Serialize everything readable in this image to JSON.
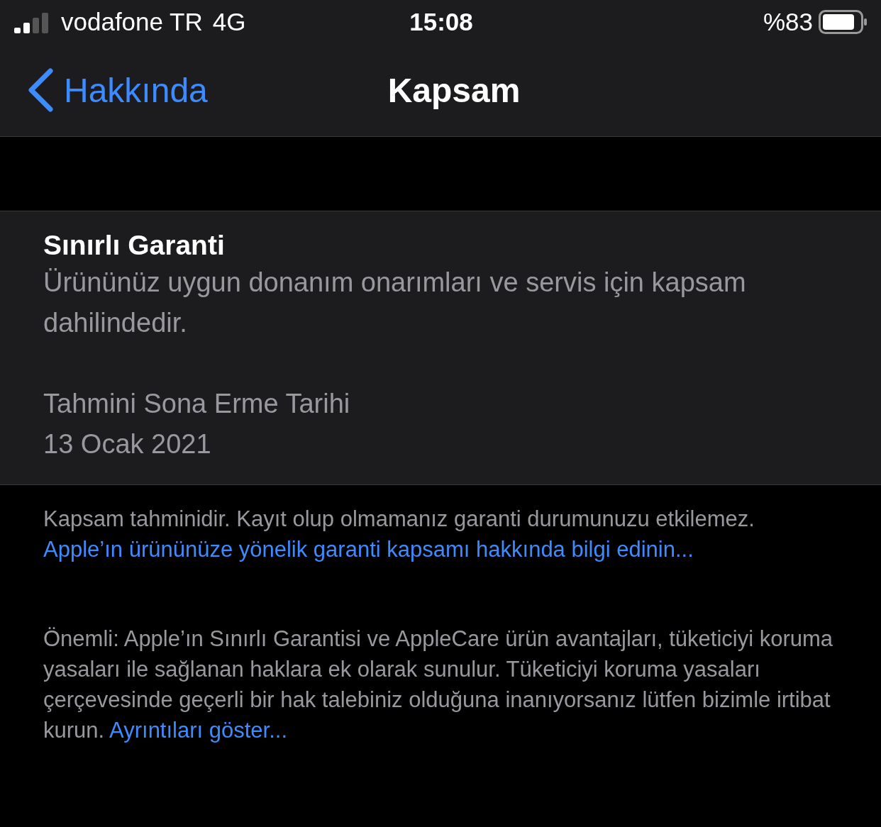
{
  "status_bar": {
    "carrier": "vodafone TR",
    "network": "4G",
    "time": "15:08",
    "battery_text": "%83"
  },
  "nav": {
    "back": "Hakkında",
    "title": "Kapsam"
  },
  "card": {
    "title": "Sınırlı Garanti",
    "description": "Ürününüz uygun donanım onarımları ve servis için kapsam dahilindedir.",
    "expiry_label": "Tahmini Sona Erme Tarihi",
    "expiry_date": "13 Ocak 2021"
  },
  "footer": [
    {
      "text": "Kapsam tahminidir. Kayıt olup olmamanız garanti durumunuzu etkilemez.",
      "link": "Apple’ın ürününüze yönelik garanti kapsamı hakkında bilgi edinin..."
    },
    {
      "text": "Önemli: Apple’ın Sınırlı Garantisi ve AppleCare ürün avantajları, tüketiciyi koruma yasaları ile sağlanan haklara ek olarak sunulur. Tüketiciyi koruma yasaları çerçevesinde geçerli bir hak talebiniz olduğuna inanıyorsanız lütfen bizimle irtibat kurun.",
      "link": "Ayrıntıları göster..."
    }
  ]
}
